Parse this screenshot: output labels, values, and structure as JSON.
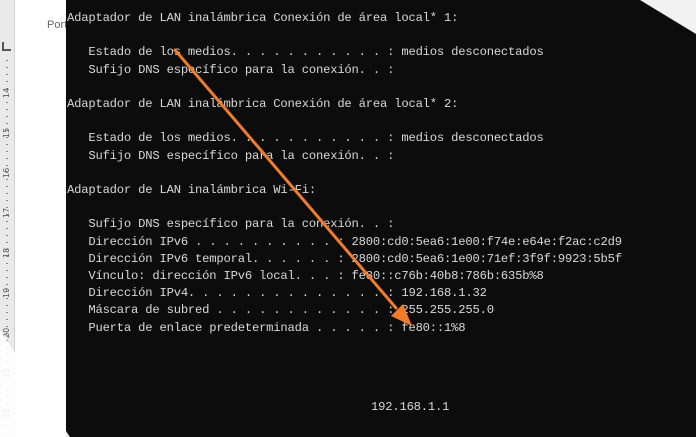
{
  "background_label": "Port",
  "ruler": {
    "ticks": [
      "14",
      "15",
      "16",
      "17",
      "18",
      "19",
      "20",
      "21",
      "22"
    ]
  },
  "terminal": {
    "lines": [
      "Adaptador de LAN inalámbrica Conexión de área local* 1:",
      "",
      "   Estado de los medios. . . . . . . . . . . : medios desconectados",
      "   Sufijo DNS específico para la conexión. . :",
      "",
      "Adaptador de LAN inalámbrica Conexión de área local* 2:",
      "",
      "   Estado de los medios. . . . . . . . . . . : medios desconectados",
      "   Sufijo DNS específico para la conexión. . :",
      "",
      "Adaptador de LAN inalámbrica Wi-Fi:",
      "",
      "   Sufijo DNS específico para la conexión. . :",
      "   Dirección IPv6 . . . . . . . . . . : 2800:cd0:5ea6:1e00:f74e:e64e:f2ac:c2d9",
      "   Dirección IPv6 temporal. . . . . . : 2800:cd0:5ea6:1e00:71ef:3f9f:9923:5b5f",
      "   Vínculo: dirección IPv6 local. . . : fe80::c76b:40b8:786b:635b%8",
      "   Dirección IPv4. . . . . . . . . . . . . . : 192.168.1.32",
      "   Máscara de subred . . . . . . . . . . . . : 255.255.255.0",
      "   Puerta de enlace predeterminada . . . . . : fe80::1%8"
    ],
    "gateway_ipv4": "192.168.1.1"
  },
  "annotation": {
    "arrow_color": "#f07c2a"
  }
}
